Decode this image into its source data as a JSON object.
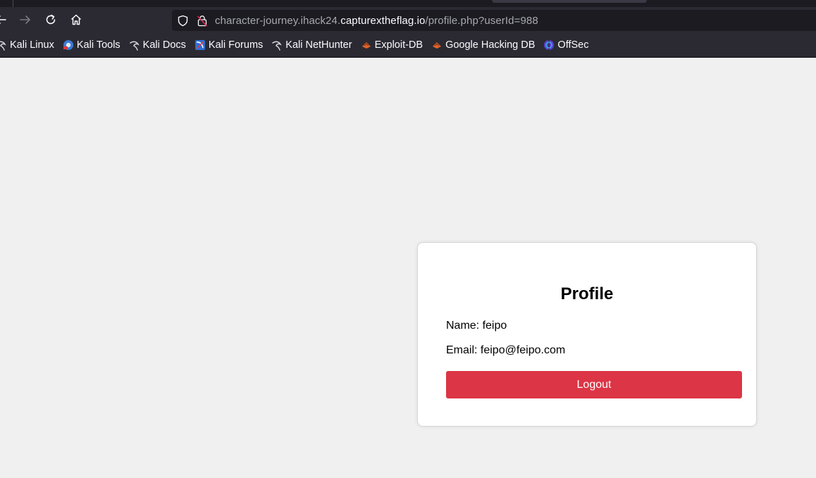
{
  "browser": {
    "url": {
      "prefix": "character-journey.ihack24.",
      "domain": "capturextheflag.io",
      "path": "/profile.php?userId=988"
    },
    "bookmarks": [
      {
        "label": "Kali Linux",
        "icon": "kali-dragon-icon"
      },
      {
        "label": "Kali Tools",
        "icon": "kali-tools-icon"
      },
      {
        "label": "Kali Docs",
        "icon": "kali-dragon-icon"
      },
      {
        "label": "Kali Forums",
        "icon": "kali-forums-icon"
      },
      {
        "label": "Kali NetHunter",
        "icon": "kali-dragon-icon"
      },
      {
        "label": "Exploit-DB",
        "icon": "exploit-db-icon"
      },
      {
        "label": "Google Hacking DB",
        "icon": "exploit-db-icon"
      },
      {
        "label": "OffSec",
        "icon": "offsec-icon"
      }
    ]
  },
  "profile": {
    "title": "Profile",
    "name_label": "Name: feipo",
    "email_label": "Email: feipo@feipo.com",
    "logout_label": "Logout"
  },
  "colors": {
    "logout_button": "#dc3545",
    "chrome_bg": "#2b2a33",
    "urlbar_bg": "#1c1b22",
    "page_bg": "#f0f0f0"
  }
}
